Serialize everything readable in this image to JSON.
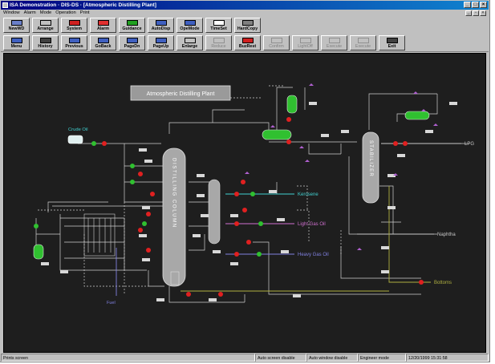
{
  "window": {
    "title": "ISA Demonstration · DIS-DS · [Atmospheric Distilling Plant]"
  },
  "menu": [
    "Window",
    "Alarm",
    "Mode",
    "Operation",
    "Print"
  ],
  "toolbar1": [
    {
      "label": "NewWD",
      "color": "#6a7fc8"
    },
    {
      "label": "Arrange",
      "color": "#c0c0c0"
    },
    {
      "label": "System",
      "color": "#d02020"
    },
    {
      "label": "Alarm",
      "color": "#e03030"
    },
    {
      "label": "Guidance",
      "color": "#20a020"
    },
    {
      "label": "AutoDisp",
      "color": "#4060c0"
    },
    {
      "label": "OpeMode",
      "color": "#4060c0"
    },
    {
      "label": "TimeSet",
      "color": "#ffffff"
    },
    {
      "label": "HardCopy",
      "color": "#808080"
    }
  ],
  "toolbar2": [
    {
      "label": "Menu",
      "color": "#4060c0",
      "disabled": false
    },
    {
      "label": "History",
      "color": "#404040",
      "disabled": false
    },
    {
      "label": "Previous",
      "color": "#4060c0",
      "disabled": false
    },
    {
      "label": "GoBack",
      "color": "#4060c0",
      "disabled": false
    },
    {
      "label": "PageDn",
      "color": "#4060c0",
      "disabled": false
    },
    {
      "label": "PageUp",
      "color": "#4060c0",
      "disabled": false
    },
    {
      "label": "Enlarge",
      "color": "#c0c0c0",
      "disabled": false
    },
    {
      "label": "Reduce",
      "color": "#c0c0c0",
      "disabled": true
    },
    {
      "label": "BuzRest",
      "color": "#d02020",
      "disabled": false
    },
    {
      "label": "Confirm",
      "color": "#c0c0c0",
      "disabled": true
    },
    {
      "label": "LightOff",
      "color": "#c0c0c0",
      "disabled": true
    },
    {
      "label": "Execute",
      "color": "#c0c0c0",
      "disabled": true
    },
    {
      "label": "Execute",
      "color": "#c0c0c0",
      "disabled": true
    },
    {
      "label": "Exit",
      "color": "#404040",
      "disabled": false
    }
  ],
  "diagram": {
    "title": "Atmospheric Distilling Plant",
    "column_label": "DISTILLING COLUMN",
    "stabilizer_label": "STABILIZER",
    "feed_label": "Crude Oil",
    "fuel_label": "Fuel",
    "products": [
      {
        "label": "LPG",
        "color": "#c8c8c8"
      },
      {
        "label": "Kerosene",
        "color": "#40d0d0"
      },
      {
        "label": "Light Gas Oil",
        "color": "#d070d0"
      },
      {
        "label": "Heavy Gas Oil",
        "color": "#8080e0"
      },
      {
        "label": "Naphtha",
        "color": "#c8c8c8"
      },
      {
        "label": "Bottoms",
        "color": "#b0b040"
      }
    ]
  },
  "status": {
    "left": "Prints screen",
    "screen": "Auto screen disable",
    "window": "Auto window disable",
    "mode": "Engineer mode",
    "datetime": "12/20/1999 15:31:58"
  }
}
